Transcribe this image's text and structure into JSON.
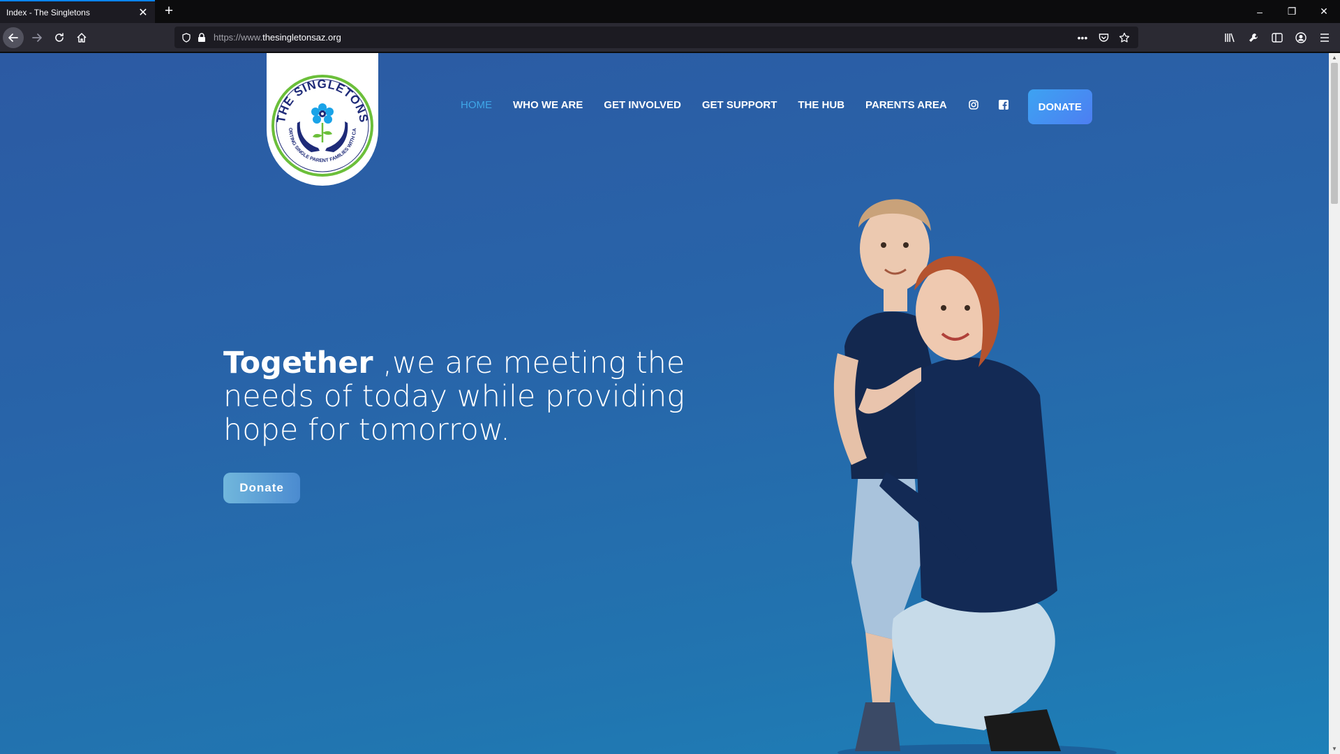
{
  "browser": {
    "tab_title": "Index - The Singletons",
    "tab_close": "✕",
    "new_tab": "+",
    "url_prefix": "https://www.",
    "url_domain": "thesingletonsaz.org",
    "url_more": "•••"
  },
  "window_controls": {
    "minimize": "–",
    "restore": "❐",
    "close": "✕"
  },
  "site": {
    "logo_text_top": "THE SINGLETONS",
    "logo_text_bottom": "SUPPORTING SINGLE PARENT FAMILIES WITH CANCER",
    "nav": [
      {
        "label": "HOME",
        "active": true
      },
      {
        "label": "WHO WE ARE"
      },
      {
        "label": "GET INVOLVED"
      },
      {
        "label": "GET SUPPORT"
      },
      {
        "label": "THE HUB"
      },
      {
        "label": "PARENTS AREA"
      }
    ],
    "nav_donate": "DONATE",
    "social": [
      "instagram-icon",
      "facebook-icon"
    ]
  },
  "hero": {
    "headline_bold": "Together",
    "headline_rest": " ,we are meeting the needs of today while providing hope for tomorrow.",
    "donate_label": "Donate"
  },
  "colors": {
    "accent_active": "#3fa7e8",
    "donate_gradient_start": "#3da3f2",
    "donate_gradient_end": "#4d7ef2",
    "hero_bg": "#2864a9",
    "logo_navy": "#1e2a78",
    "logo_green": "#6bbf3a",
    "logo_flower": "#1aa3e8"
  }
}
